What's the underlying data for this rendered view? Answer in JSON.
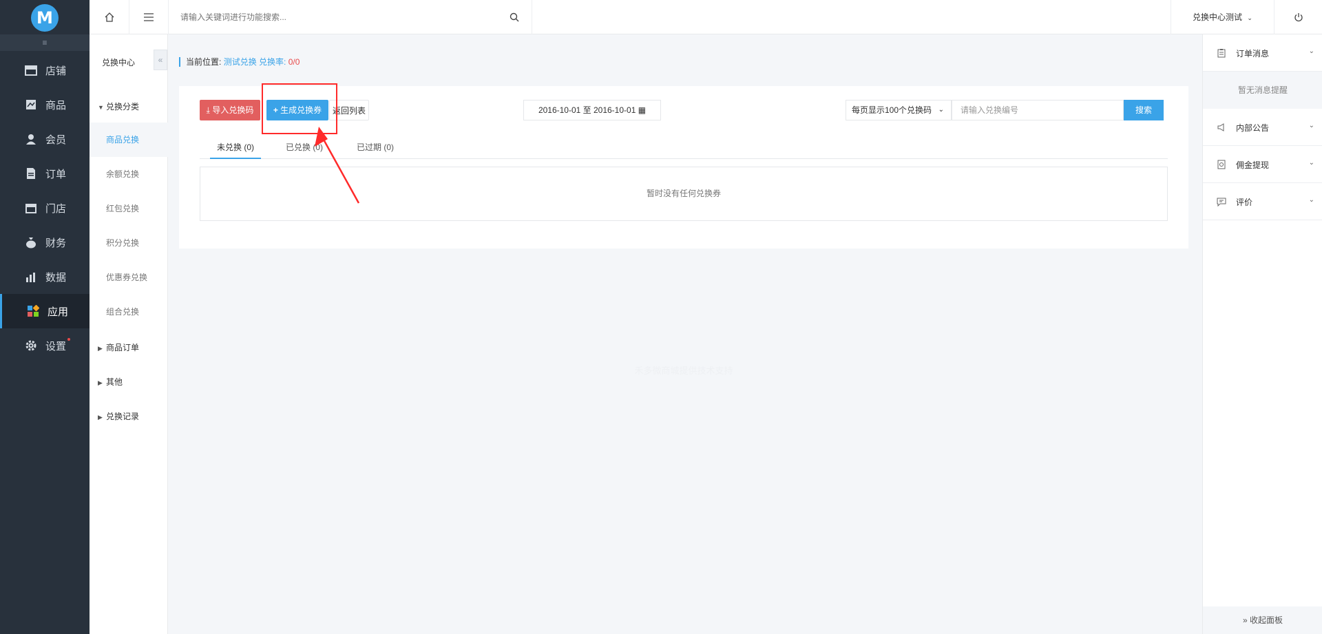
{
  "sidebar": {
    "logo": "M",
    "collapse_icon": "indent-icon",
    "items": [
      {
        "label": "店铺",
        "icon": "store-icon"
      },
      {
        "label": "商品",
        "icon": "goods-icon"
      },
      {
        "label": "会员",
        "icon": "user-icon"
      },
      {
        "label": "订单",
        "icon": "order-icon"
      },
      {
        "label": "门店",
        "icon": "shop-icon"
      },
      {
        "label": "财务",
        "icon": "money-bag-icon"
      },
      {
        "label": "数据",
        "icon": "chart-icon"
      },
      {
        "label": "应用",
        "icon": "apps-icon",
        "active": true
      },
      {
        "label": "设置",
        "icon": "gear-icon"
      }
    ]
  },
  "subnav": {
    "title": "兑换中心",
    "toggle": "«",
    "groups": [
      {
        "label": "兑换分类",
        "expanded": true
      },
      {
        "label": "商品订单"
      },
      {
        "label": "其他"
      },
      {
        "label": "兑换记录"
      }
    ],
    "items": [
      {
        "label": "商品兑换",
        "active": true
      },
      {
        "label": "余额兑换"
      },
      {
        "label": "红包兑换"
      },
      {
        "label": "积分兑换"
      },
      {
        "label": "优惠券兑换"
      },
      {
        "label": "组合兑换"
      }
    ]
  },
  "topbar": {
    "search_placeholder": "请输入关键词进行功能搜索...",
    "user_label": "兑换中心测试"
  },
  "breadcrumb": {
    "prefix": "当前位置:",
    "link": "测试兑换",
    "rate_label": "兑换率:",
    "rate_value": "0/0"
  },
  "toolbar": {
    "import_label": "导入兑换码",
    "generate_label": "生成兑换券",
    "back_label": "返回列表",
    "date_range": "2016-10-01 至 2016-10-01",
    "per_page": "每页显示100个兑换码",
    "code_placeholder": "请输入兑换编号",
    "search_label": "搜索"
  },
  "tabs": [
    {
      "label": "未兑换 (0)",
      "active": true
    },
    {
      "label": "已兑换 (0)"
    },
    {
      "label": "已过期 (0)"
    }
  ],
  "empty_text": "暂时没有任何兑换券",
  "footer_note": "禾多微商城提供技术支持",
  "right_panel": {
    "sections": [
      {
        "label": "订单消息",
        "icon": "clipboard-icon"
      },
      {
        "label": "内部公告",
        "icon": "megaphone-icon"
      },
      {
        "label": "佣金提现",
        "icon": "withdraw-icon"
      },
      {
        "label": "评价",
        "icon": "comment-icon"
      }
    ],
    "empty": "暂无消息提醒",
    "collapse_label": "» 收起面板"
  },
  "colors": {
    "accent": "#3aa3e8",
    "danger": "#e25f5f",
    "sidebar": "#28313c",
    "annotation": "#ff2a2a"
  }
}
